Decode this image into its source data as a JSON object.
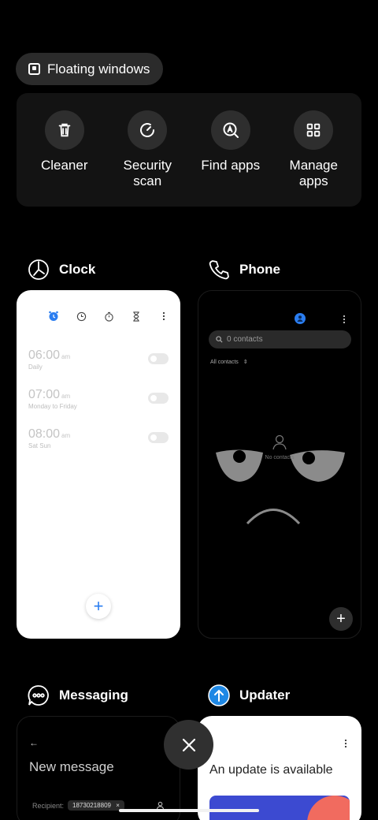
{
  "floating_windows_label": "Floating windows",
  "tools": [
    {
      "label": "Cleaner",
      "icon": "trash-icon"
    },
    {
      "label": "Security\nscan",
      "icon": "security-scan-icon"
    },
    {
      "label": "Find apps",
      "icon": "find-apps-icon"
    },
    {
      "label": "Manage\napps",
      "icon": "grid-icon"
    }
  ],
  "apps": {
    "clock": {
      "name": "Clock",
      "alarms": [
        {
          "time": "06:00",
          "ampm": "am",
          "repeat": "Daily"
        },
        {
          "time": "07:00",
          "ampm": "am",
          "repeat": "Monday to Friday"
        },
        {
          "time": "08:00",
          "ampm": "am",
          "repeat": "Sat Sun"
        }
      ],
      "accent": "#2a7df0"
    },
    "phone": {
      "name": "Phone",
      "search_placeholder": "0 contacts",
      "filter_label": "All contacts",
      "empty_label": "No contacts"
    },
    "messaging": {
      "name": "Messaging",
      "title": "New message",
      "recipient_label": "Recipient:",
      "recipient_chip": "18730218809"
    },
    "updater": {
      "name": "Updater",
      "title": "An update is available",
      "accent": "#1e88e5"
    }
  }
}
